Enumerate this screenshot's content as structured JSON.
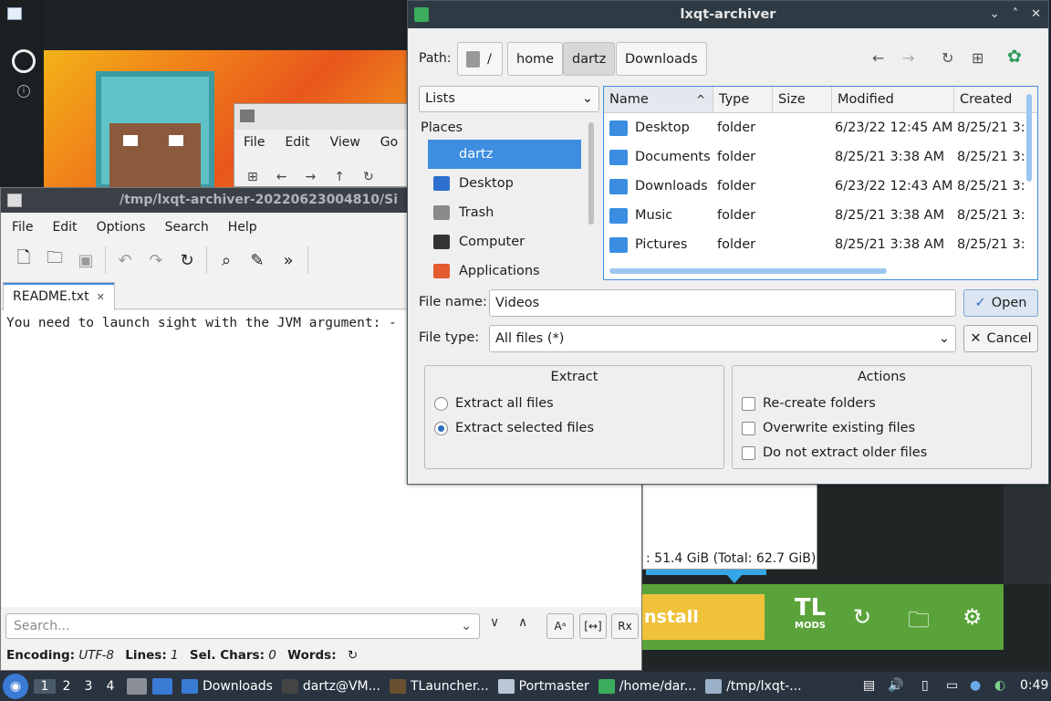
{
  "editor": {
    "title": "/tmp/lxqt-archiver-20220623004810/Si",
    "menu": [
      "File",
      "Edit",
      "Options",
      "Search",
      "Help"
    ],
    "tab": "README.txt",
    "tab_close": "✕",
    "text": "You need to launch sight with the JVM argument: -",
    "search_placeholder": "Search...",
    "status": {
      "encoding_label": "Encoding:",
      "encoding": "UTF-8",
      "lines_label": "Lines:",
      "lines": "1",
      "sel_label": "Sel. Chars:",
      "sel": "0",
      "words_label": "Words:"
    },
    "search_btns": [
      "Aᵃ",
      "[↔]",
      "Rx"
    ]
  },
  "file_manager_bg": {
    "menu": [
      "File",
      "Edit",
      "View",
      "Go"
    ]
  },
  "dialog": {
    "title": "lxqt-archiver",
    "window_buttons": [
      "⌄",
      "˄",
      "✕"
    ],
    "path_label": "Path:",
    "crumbs": [
      "/",
      "home",
      "dartz",
      "Downloads"
    ],
    "places_combo": "Lists",
    "places_header": "Places",
    "places": [
      {
        "label": "dartz",
        "icon": "home-folder-icon",
        "color": "#3d8ee0"
      },
      {
        "label": "Desktop",
        "icon": "desktop-icon",
        "color": "#2f6fd0"
      },
      {
        "label": "Trash",
        "icon": "trash-icon",
        "color": "#8a8a8a"
      },
      {
        "label": "Computer",
        "icon": "computer-icon",
        "color": "#333333"
      },
      {
        "label": "Applications",
        "icon": "applications-icon",
        "color": "#e35b2f"
      }
    ],
    "columns": [
      "Name",
      "Type",
      "Size",
      "Modified",
      "Created"
    ],
    "sort_indicator": "^",
    "files": [
      {
        "name": "Desktop",
        "type": "folder",
        "size": "",
        "modified": "6/23/22 12:45 AM",
        "created": "8/25/21 3:"
      },
      {
        "name": "Documents",
        "type": "folder",
        "size": "",
        "modified": "8/25/21 3:38 AM",
        "created": "8/25/21 3:"
      },
      {
        "name": "Downloads",
        "type": "folder",
        "size": "",
        "modified": "6/23/22 12:43 AM",
        "created": "8/25/21 3:"
      },
      {
        "name": "Music",
        "type": "folder",
        "size": "",
        "modified": "8/25/21 3:38 AM",
        "created": "8/25/21 3:"
      },
      {
        "name": "Pictures",
        "type": "folder",
        "size": "",
        "modified": "8/25/21 3:38 AM",
        "created": "8/25/21 3:"
      }
    ],
    "file_name_label": "File name:",
    "file_name_value": "Videos",
    "open_label": "Open",
    "file_type_label": "File type:",
    "file_type_value": "All files (*)",
    "cancel_label": "Cancel",
    "extract_title": "Extract",
    "extract_all": "Extract all files",
    "extract_selected": "Extract selected files",
    "actions_title": "Actions",
    "recreate": "Re-create folders",
    "overwrite": "Overwrite existing files",
    "no_older": "Do not extract older files"
  },
  "launcher": {
    "install": "nstall",
    "logo_main": "TL",
    "logo_sub": "MODS",
    "disk_text": ": 51.4 GiB (Total: 62.7 GiB)"
  },
  "taskbar": {
    "desktops": [
      "1",
      "2",
      "3",
      "4"
    ],
    "tasks": [
      {
        "label": "Downloads",
        "color": "#3a7bd5"
      },
      {
        "label": "dartz@VM...",
        "color": "#444444"
      },
      {
        "label": "TLauncher...",
        "color": "#6a5030"
      },
      {
        "label": "Portmaster",
        "color": "#b9c7d6"
      },
      {
        "label": "/home/dar...",
        "color": "#3bad5c"
      },
      {
        "label": "/tmp/lxqt-...",
        "color": "#9ab0c8"
      }
    ],
    "clock": "0:49"
  }
}
